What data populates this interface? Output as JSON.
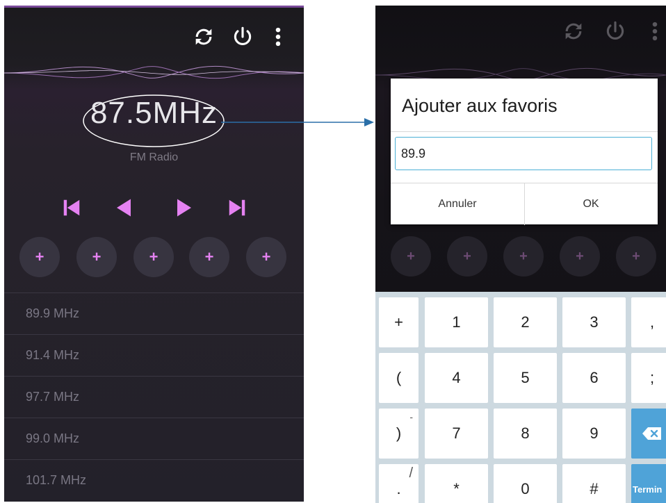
{
  "left_screen": {
    "frequency_value": "87.5",
    "frequency_unit": "MHz",
    "band_label": "FM Radio",
    "preset_symbol": "+",
    "stations": [
      "89.9 MHz",
      "91.4 MHz",
      "97.7 MHz",
      "99.0 MHz",
      "101.7 MHz"
    ]
  },
  "right_screen": {
    "dialog": {
      "title": "Ajouter aux favoris",
      "input_value": "89.9",
      "cancel_label": "Annuler",
      "ok_label": "OK"
    },
    "keyboard": {
      "row1": [
        "+",
        "1",
        "2",
        "3",
        ","
      ],
      "row2": [
        "(",
        "4",
        "5",
        "6",
        ";"
      ],
      "row3": [
        ")",
        "7",
        "8",
        "9"
      ],
      "row3_alt": "-",
      "row4": [
        ".",
        "*",
        "0",
        "#"
      ],
      "row4_alt": "/",
      "done_label": "Termin"
    }
  },
  "colors": {
    "accent": "#e582f2",
    "input_border": "#4ab0d6",
    "done_key": "#4fa3d8",
    "arrow": "#2a6fa8"
  },
  "icons": [
    "refresh-icon",
    "power-icon",
    "more-vert-icon",
    "skip-previous-icon",
    "step-back-icon",
    "play-icon",
    "skip-next-icon",
    "backspace-icon"
  ]
}
